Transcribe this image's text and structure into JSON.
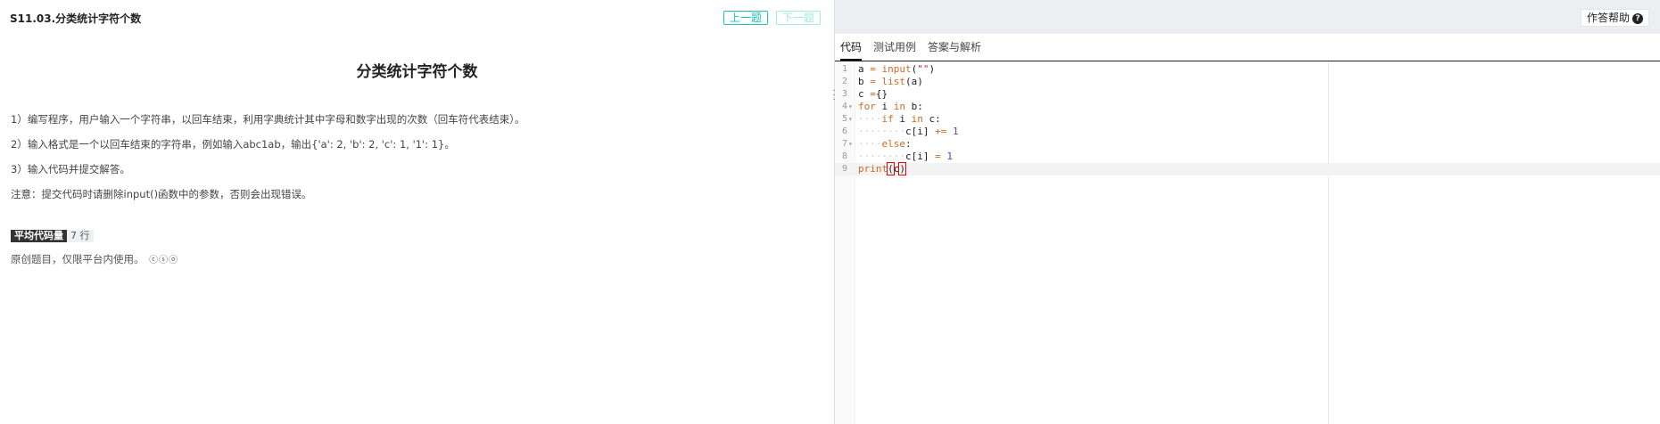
{
  "problem": {
    "breadcrumb": "S11.03.分类统计字符个数",
    "prev_label": "上一题",
    "next_label": "下一题",
    "title": "分类统计字符个数",
    "paragraphs": [
      "1）编写程序，用户输入一个字符串，以回车结束，利用字典统计其中字母和数字出现的次数（回车符代表结束）。",
      "2）输入格式是一个以回车结束的字符串，例如输入abc1ab，输出{'a': 2, 'b': 2, 'c': 1, '1': 1}。",
      "3）输入代码并提交解答。",
      "注意：提交代码时请删除input()函数中的参数，否则会出现错误。"
    ],
    "avg_code_label": "平均代码量",
    "avg_code_value": "7 行",
    "copyright": "原创题目，仅限平台内使用。",
    "license_icons": "ⓒⓢⓞ"
  },
  "editor": {
    "help_label": "作答帮助",
    "help_icon": "question-circle-icon",
    "tabs": [
      "代码",
      "测试用例",
      "答案与解析"
    ],
    "active_tab": 0,
    "line_numbers": [
      "1",
      "2",
      "3",
      "4",
      "5",
      "6",
      "7",
      "8",
      "9"
    ],
    "code_lines": [
      "a = input(\"\")",
      "b = list(a)",
      "c ={}",
      "for i in b:",
      "    if i in c:",
      "        c[i] += 1",
      "    else:",
      "        c[i] = 1",
      "print(c)"
    ],
    "cursor_line": 9,
    "colors": {
      "accent": "#1fc1b0",
      "keyword": "#d2691e",
      "string": "#cc3333",
      "number": "#6a3db4"
    }
  }
}
